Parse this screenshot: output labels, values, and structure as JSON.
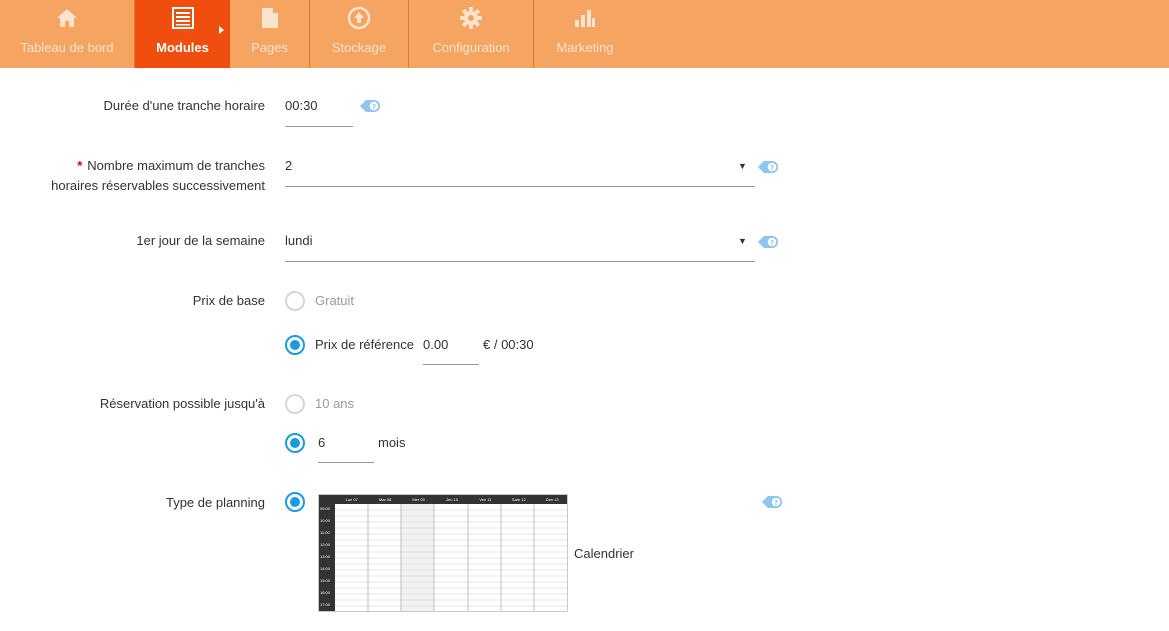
{
  "nav": [
    {
      "label": "Tableau de bord",
      "icon": "home-icon",
      "active": false
    },
    {
      "label": "Modules",
      "icon": "modules-icon",
      "active": true
    },
    {
      "label": "Pages",
      "icon": "page-icon",
      "active": false
    },
    {
      "label": "Stockage",
      "icon": "upload-icon",
      "active": false
    },
    {
      "label": "Configuration",
      "icon": "gear-icon",
      "active": false
    },
    {
      "label": "Marketing",
      "icon": "bar-chart-icon",
      "active": false
    }
  ],
  "form": {
    "slot_duration": {
      "label": "Durée d'une tranche horaire",
      "value": "00:30"
    },
    "max_slots": {
      "label_line1": "Nombre maximum de tranches",
      "label_line2": "horaires réservables successivement",
      "required_mark": "*",
      "value": "2"
    },
    "first_day": {
      "label": "1er jour de la semaine",
      "value": "lundi"
    },
    "base_price": {
      "label": "Prix de base",
      "option_free": "Gratuit",
      "option_ref_label": "Prix de référence",
      "option_ref_value": "0.00",
      "option_ref_suffix": "€ / 00:30"
    },
    "booking_limit": {
      "label": "Réservation possible jusqu'à",
      "option_years": "10 ans",
      "option_months_value": "6",
      "option_months_suffix": "mois"
    },
    "planning_type": {
      "label": "Type de planning",
      "option_label": "Calendrier"
    }
  },
  "calendar_thumb": {
    "days": [
      "Lun 07",
      "Mar 08",
      "Mer 09",
      "Jeu 10",
      "Ven 11",
      "Sam 12",
      "Dim 13"
    ],
    "hours": [
      "09:00",
      "10:00",
      "11:00",
      "12:00",
      "13:00",
      "14:00",
      "15:00",
      "16:00",
      "17:00"
    ]
  },
  "colors": {
    "nav_bg": "#f5a462",
    "nav_active": "#f04e0f",
    "radio_on": "#1a9be0",
    "help_icon": "#8ec6ee"
  }
}
